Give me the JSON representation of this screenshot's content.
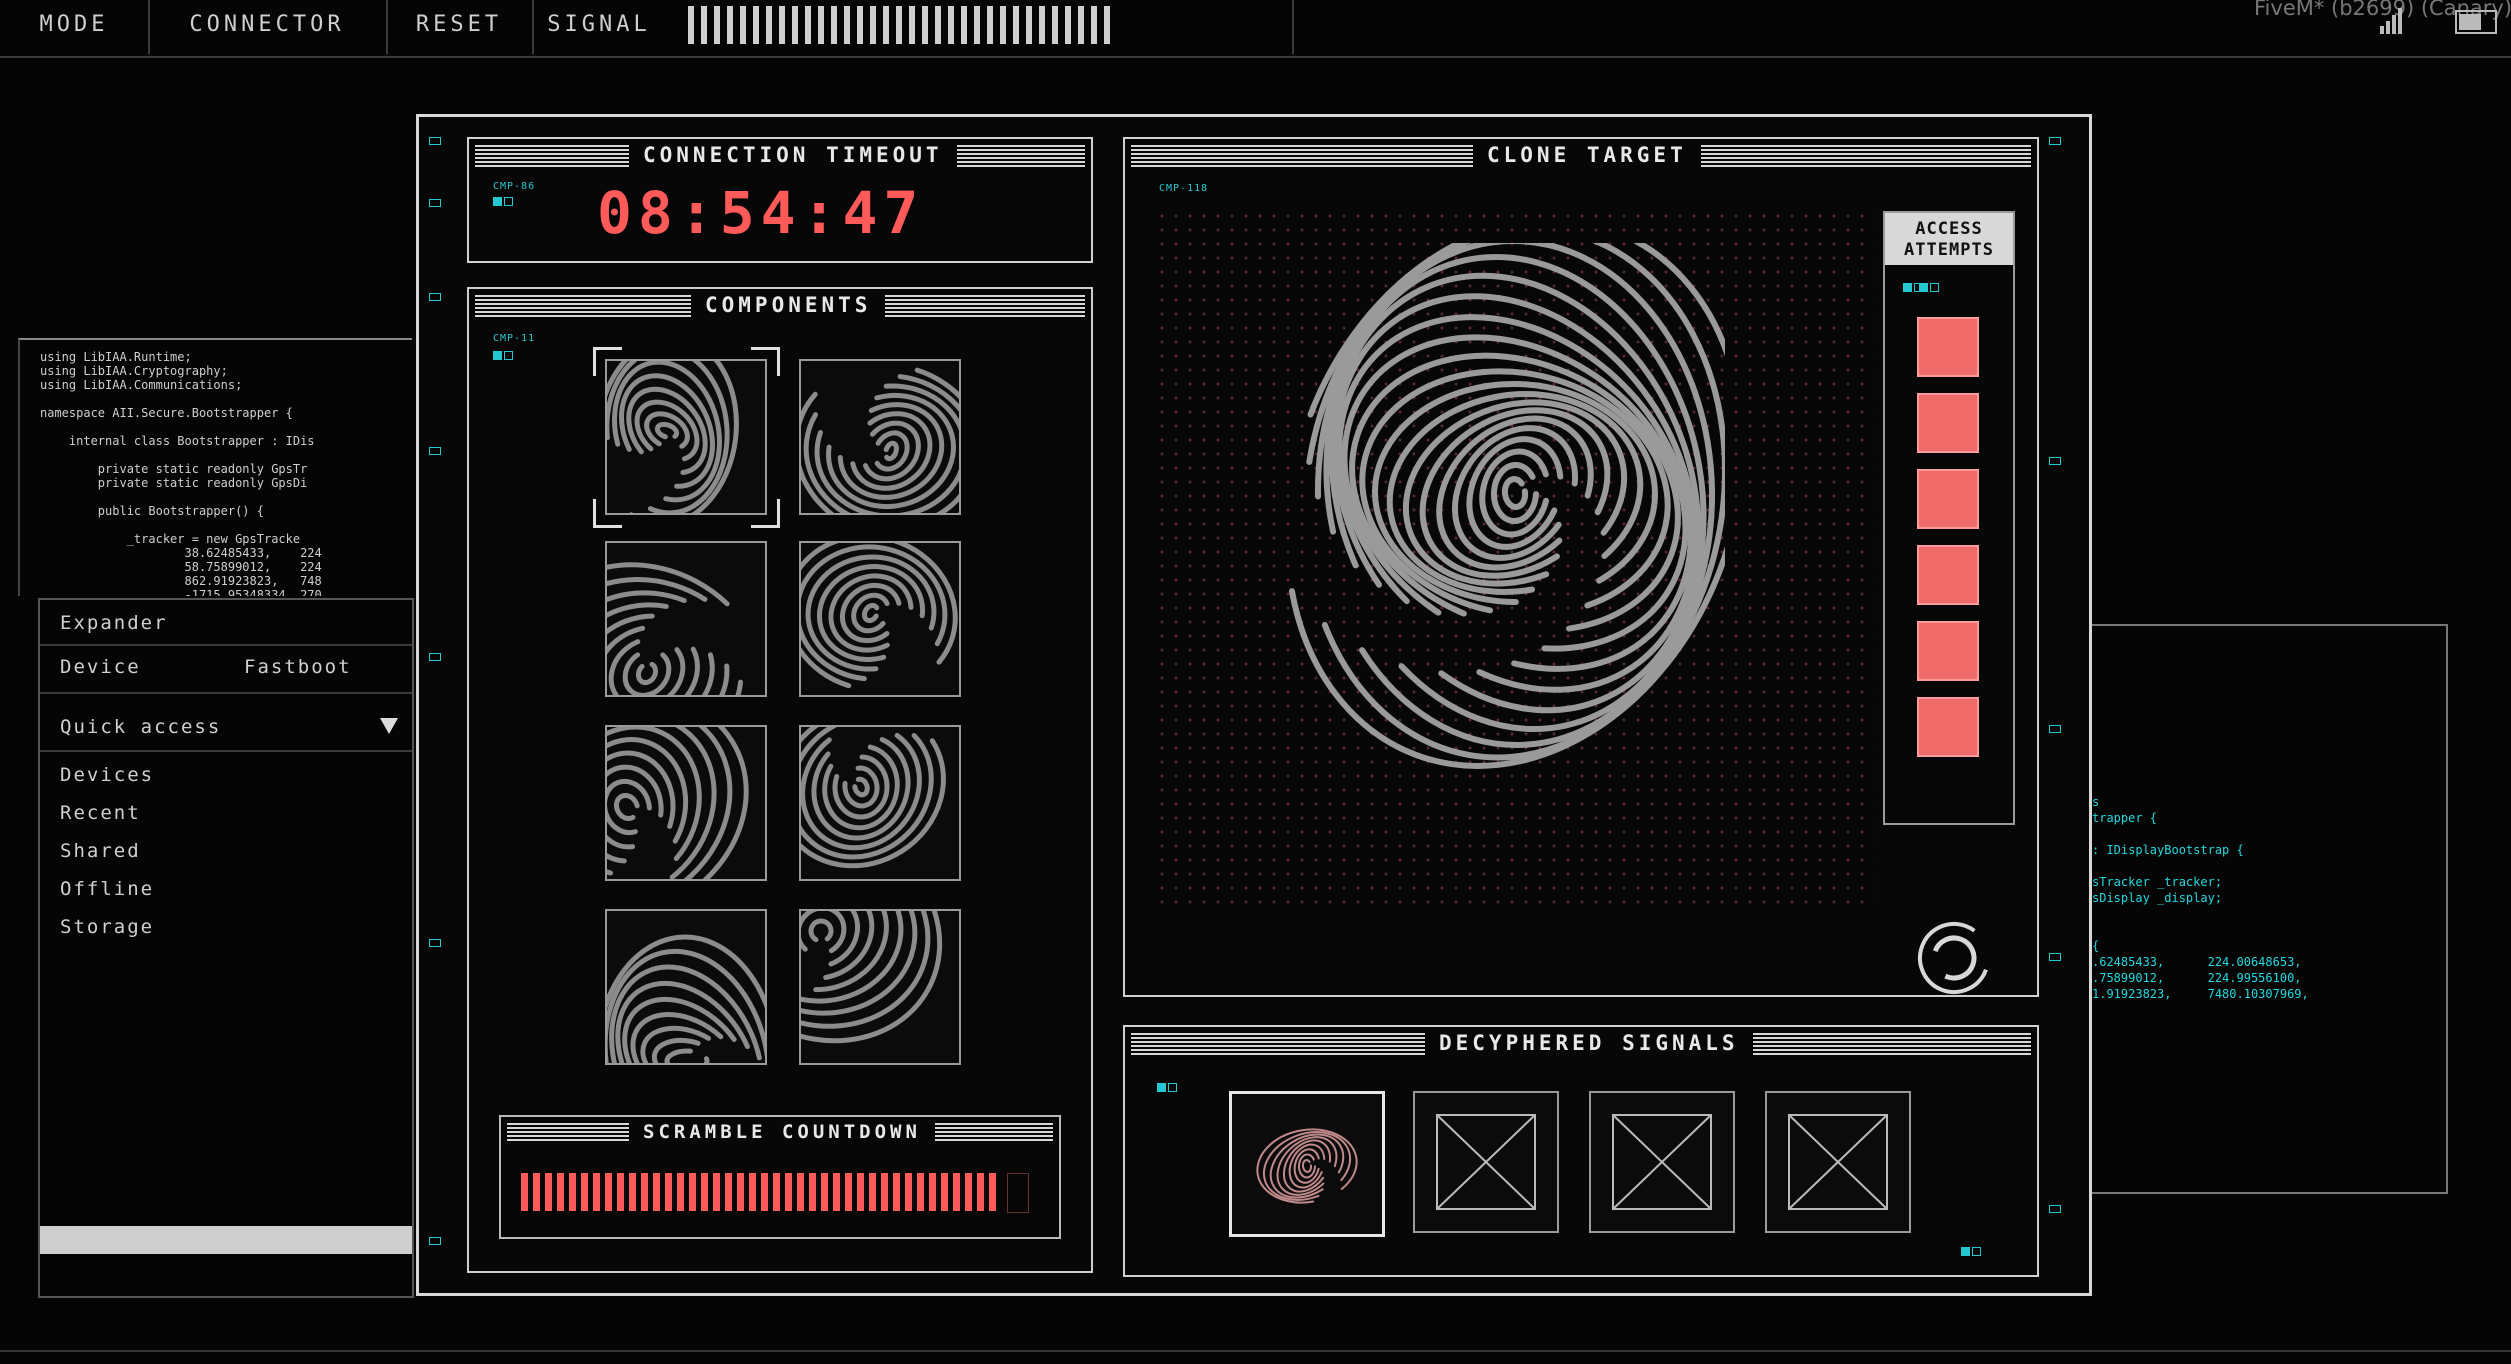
{
  "topbar": {
    "mode": "MODE",
    "connector": "CONNECTOR",
    "reset": "RESET",
    "signal": "SIGNAL",
    "app_title": "FiveM* (b2699) (Canary)"
  },
  "code_panel": {
    "lines": "using LibIAA.Runtime;\nusing LibIAA.Cryptography;\nusing LibIAA.Communications;\n\nnamespace AII.Secure.Bootstrapper {\n\n    internal class Bootstrapper : IDis\n\n        private static readonly GpsTr\n        private static readonly GpsDi\n\n        public Bootstrapper() {\n\n            _tracker = new GpsTracke\n                    38.62485433,    224\n                    58.75899012,    224\n                    862.91923823,   748\n                    -1715.95348334, 270"
  },
  "side_menu": {
    "expander": "Expander",
    "device": "Device",
    "fastboot": "Fastboot",
    "quick_access": "Quick access",
    "items": [
      "Devices",
      "Recent",
      "Shared",
      "Offline",
      "Storage"
    ]
  },
  "right_code": {
    "lines": "s\ntrapper {\n\n: IDisplayBootstrap {\n\nsTracker _tracker;\nsDisplay _display;\n\n\n{\n.62485433,      224.00648653,\n.75899012,      224.99556100,\n1.91923823,     7480.10307969,"
  },
  "timer_panel": {
    "title": "CONNECTION TIMEOUT",
    "tag": "CMP-86",
    "time": "08:54:47"
  },
  "components_panel": {
    "title": "COMPONENTS",
    "tag": "CMP-11",
    "selected_index": 0
  },
  "scramble": {
    "title": "SCRAMBLE COUNTDOWN"
  },
  "clone_panel": {
    "title": "CLONE TARGET",
    "tag": "CMP-118",
    "attempts_title_1": "ACCESS",
    "attempts_title_2": "ATTEMPTS",
    "attempts_remaining": 6
  },
  "decyphered_panel": {
    "title": "DECYPHERED SIGNALS",
    "slots": [
      "fingerprint",
      "empty",
      "empty",
      "empty"
    ]
  },
  "colors": {
    "accent_red": "#ff5a5a",
    "accent_cyan": "#23c8d0",
    "frame": "#d8d8d8"
  },
  "icons": [
    "signal-bars-icon",
    "wifi-icon",
    "battery-icon",
    "dropdown-arrow-icon",
    "fingerprint-icon",
    "reload-icon",
    "empty-slot-icon"
  ]
}
